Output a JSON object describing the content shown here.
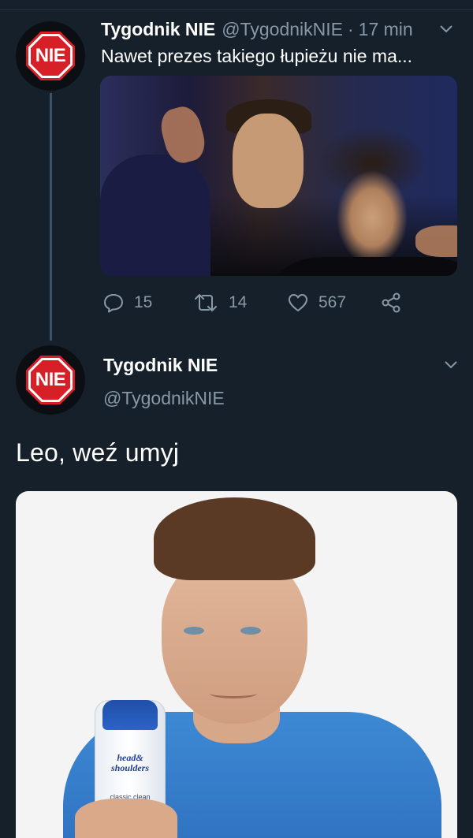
{
  "tweet1": {
    "name": "Tygodnik NIE",
    "handle": "@TygodnikNIE",
    "separator": "·",
    "time": "17 min",
    "text": "Nawet prezes takiego łupieżu nie ma...",
    "avatar_text": "NIE",
    "actions": {
      "replies": "15",
      "retweets": "14",
      "likes": "567"
    }
  },
  "tweet2": {
    "name": "Tygodnik NIE",
    "handle": "@TygodnikNIE",
    "avatar_text": "NIE",
    "text": "Leo, weź umyj",
    "product": {
      "brand": "head& shoulders",
      "variant": "classic clean"
    }
  },
  "colors": {
    "background": "#15202b",
    "secondary_text": "#8899a6",
    "thread_line": "#3d5466",
    "stop_red": "#d61f26"
  },
  "icons": [
    "chevron-down-icon",
    "reply-icon",
    "retweet-icon",
    "like-icon",
    "share-icon"
  ]
}
